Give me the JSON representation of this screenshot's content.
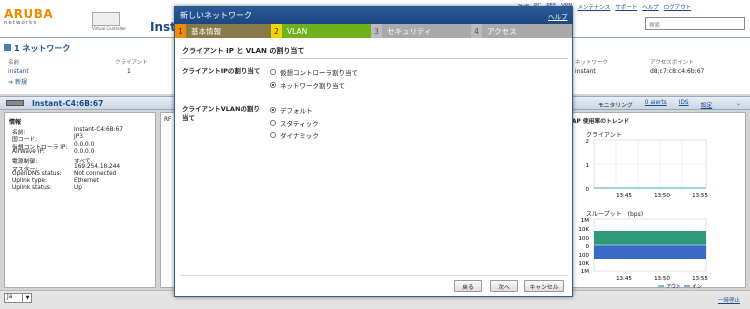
{
  "header": {
    "logo_main": "ARUBA",
    "logo_sub": "networks",
    "vc_caption": "Virtual Controller",
    "title": "Instant",
    "nav": [
      "監視",
      "PC",
      "PEF",
      "VPN",
      "メンテナンス",
      "サポート",
      "ヘルプ",
      "ログアウト"
    ],
    "search_placeholder": "検索"
  },
  "networks": {
    "title": "1 ネットワーク",
    "col_name": "名前",
    "col_clients": "クライアント",
    "col_network": "ネットワーク",
    "col_ap": "アクセスポイント",
    "row_name": "instant",
    "row_clients": "1",
    "row_network": "instant",
    "row_ap": "d8:c7:c8:c4:6b:67",
    "new_link": "新規"
  },
  "instant_bar": {
    "name": "Instant-C4:6B:67",
    "monitoring": "モニタリング",
    "alerts": "0 alerts",
    "ids": "IDS",
    "config": "設定"
  },
  "info": {
    "title": "情報",
    "rows": [
      {
        "k": "名前:",
        "v": "Instant-C4:6B:67"
      },
      {
        "k": "国コード:",
        "v": "JP3"
      },
      {
        "k": "仮想コントローラ IP:",
        "v": "0.0.0.0"
      },
      {
        "k": "AirWave IP:",
        "v": "0.0.0.0"
      },
      {
        "k": "電源制御:",
        "v": "すべて"
      },
      {
        "k": "マスター:",
        "v": "169.254.18.244"
      },
      {
        "k": "OpenDNS status:",
        "v": "Not connected"
      },
      {
        "k": "Uplink type:",
        "v": "Ethernet"
      },
      {
        "k": "Uplink status:",
        "v": "Up"
      }
    ],
    "rf_label": "RF"
  },
  "trends": {
    "title": "AP 使用率のトレンド",
    "clients_label": "クライアント",
    "clients_ticks": [
      "2",
      "1",
      "0"
    ],
    "clients_times": [
      "13:45",
      "13:50",
      "13:55"
    ],
    "throughput_label": "スループット　(bps)",
    "tp_ticks": [
      "1M",
      "10K",
      "100",
      "0",
      "100",
      "10K",
      "1M"
    ],
    "tp_times": [
      "13:45",
      "13:50",
      "13:55"
    ],
    "legend_out": "アウト",
    "legend_in": "イン",
    "colors": {
      "out": "#2f9a7a",
      "in": "#3a6ac8"
    }
  },
  "modal": {
    "title": "新しいネットワーク",
    "help": "ヘルプ",
    "steps": [
      {
        "n": "1",
        "label": "基本情報"
      },
      {
        "n": "2",
        "label": "VLAN"
      },
      {
        "n": "3",
        "label": "セキュリティ"
      },
      {
        "n": "4",
        "label": "アクセス"
      }
    ],
    "section_title": "クライアント IP と VLAN の割り当て",
    "ip_label": "クライアントIPの割り当て",
    "ip_options": [
      "仮想コントローラ割り当て",
      "ネットワーク割り当て"
    ],
    "vlan_label_1": "クライアントVLANの割り",
    "vlan_label_2": "当て",
    "vlan_options": [
      "デフォルト",
      "スタティック",
      "ダイナミック"
    ],
    "btn_back": "戻る",
    "btn_next": "次へ",
    "btn_cancel": "キャンセル"
  },
  "footer": {
    "language": "Ja",
    "update_link": "一時停止"
  }
}
